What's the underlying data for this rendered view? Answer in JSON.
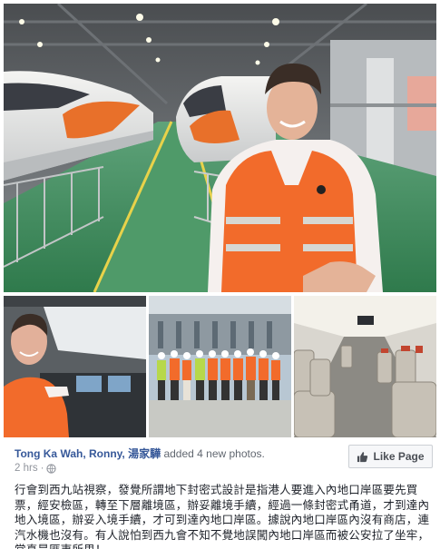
{
  "post": {
    "author": "Tong Ka Wah, Ronny, 湯家驊",
    "action": "added 4 new photos.",
    "time": "2 hrs",
    "privacy_icon": "globe-icon",
    "like_page_label": "Like Page",
    "like_icon": "thumbs-up-icon",
    "body": "行會到西九站視察，發覺所謂地下封密式設計是指港人要進入內地口岸區要先買票，經安檢區，轉至下層離境區，辦妥離境手續，經過一條封密式甬道，才到達內地入境區，辦妥入境手續，才可到達內地口岸區。據說內地口岸區內沒有商店，連汽水機也沒有。有人說怕到西九會不知不覺地誤闖內地口岸區而被公安拉了坐牢，當真是匪夷所思！"
  },
  "colors": {
    "link_blue": "#365899",
    "meta_grey": "#90949c",
    "vest_orange": "#f26b2b",
    "train_orange": "#e8702a",
    "track_green": "#3b8c5a"
  }
}
